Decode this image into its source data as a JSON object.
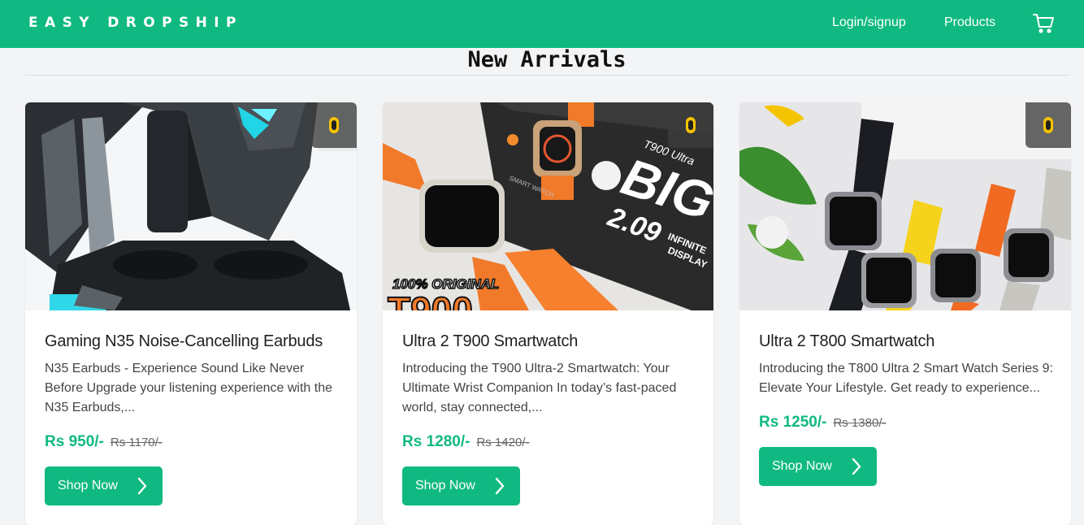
{
  "brand": "EASY DROPSHIP",
  "nav": {
    "login": "Login/signup",
    "products": "Products",
    "cart_icon": "cart-icon"
  },
  "section": {
    "title": "New Arrivals"
  },
  "colors": {
    "accent": "#10b981",
    "background": "#f3f4f6"
  },
  "products": [
    {
      "title": "Gaming N35 Noise-Cancelling Earbuds",
      "desc": "N35 Earbuds - Experience Sound Like Never Before Upgrade your listening experience with the N35 Earbuds,...",
      "price": "Rs 950/-",
      "old_price": "Rs 1170/-",
      "button": "Shop Now"
    },
    {
      "title": "Ultra 2 T900 Smartwatch",
      "desc": "Introducing the T900 Ultra-2 Smartwatch: Your Ultimate Wrist Companion In today’s fast-paced world, stay connected,...",
      "price": "Rs 1280/-",
      "old_price": "Rs 1420/-",
      "button": "Shop Now",
      "image_text": {
        "top_label": "T900 Ultra",
        "big": "BIG",
        "size": "2.09",
        "infinite": "INFINITE",
        "display": "DISPLAY",
        "original": "100% ORIGINAL",
        "model": "T900",
        "box_label": "SMART WATCH"
      }
    },
    {
      "title": "Ultra 2 T800 Smartwatch",
      "desc": "Introducing the T800 Ultra 2 Smart Watch Series 9: Elevate Your Lifestyle. Get ready to experience...",
      "price": "Rs 1250/-",
      "old_price": "Rs 1380/-",
      "button": "Shop Now"
    }
  ]
}
